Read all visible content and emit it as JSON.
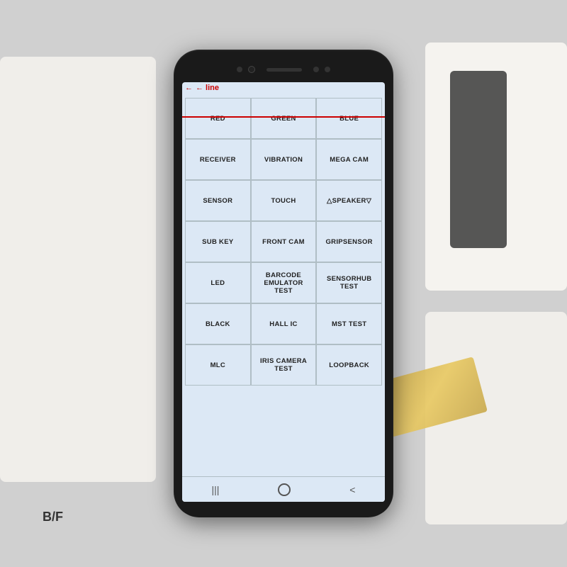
{
  "scene": {
    "label_bf": "B/F",
    "annotation": {
      "line_label": "← line"
    }
  },
  "phone": {
    "screen": {
      "background_color": "#dce8f5",
      "red_line": true,
      "grid": {
        "rows": [
          [
            {
              "id": "red",
              "label": "RED"
            },
            {
              "id": "green",
              "label": "GREEN"
            },
            {
              "id": "blue",
              "label": "BLUE"
            }
          ],
          [
            {
              "id": "receiver",
              "label": "RECEIVER"
            },
            {
              "id": "vibration",
              "label": "VIBRATION"
            },
            {
              "id": "mega-cam",
              "label": "MEGA CAM"
            }
          ],
          [
            {
              "id": "sensor",
              "label": "SENSOR"
            },
            {
              "id": "touch",
              "label": "TOUCH"
            },
            {
              "id": "speaker",
              "label": "△SPEAKER▽"
            }
          ],
          [
            {
              "id": "sub-key",
              "label": "SUB KEY"
            },
            {
              "id": "front-cam",
              "label": "FRONT CAM"
            },
            {
              "id": "gripsensor",
              "label": "GRIPSENSOR"
            }
          ],
          [
            {
              "id": "led",
              "label": "LED"
            },
            {
              "id": "barcode-emulator",
              "label": "BARCODE\nEMULATOR TEST"
            },
            {
              "id": "sensorhub",
              "label": "SENSORHUB TEST"
            }
          ],
          [
            {
              "id": "black",
              "label": "BLACK"
            },
            {
              "id": "hall-ic",
              "label": "HALL IC"
            },
            {
              "id": "mst-test",
              "label": "MST TEST"
            }
          ],
          [
            {
              "id": "mlc",
              "label": "MLC"
            },
            {
              "id": "iris-camera",
              "label": "IRIS CAMERA\nTEST"
            },
            {
              "id": "loopback",
              "label": "LOOPBACK"
            }
          ]
        ]
      },
      "bottom_nav": {
        "back_icon": "|||",
        "home_icon": "○",
        "recent_icon": "<"
      }
    }
  }
}
